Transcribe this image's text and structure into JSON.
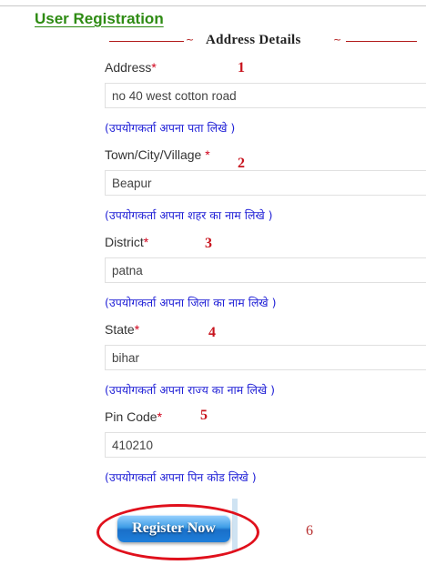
{
  "page_title": "User Registration",
  "section": {
    "ornament_left": "~",
    "heading": "Address Details",
    "ornament_right": "~"
  },
  "fields": [
    {
      "label": "Address",
      "required_mark": "*",
      "value": "no 40 west cotton road",
      "hint": "(उपयोगकर्ता अपना पता लिखे )",
      "annotation": "1"
    },
    {
      "label": "Town/City/Village ",
      "required_mark": "*",
      "value": "Beapur",
      "hint": "(उपयोगकर्ता अपना शहर का नाम लिखे )",
      "annotation": "2"
    },
    {
      "label": "District",
      "required_mark": "*",
      "value": "patna",
      "hint": "(उपयोगकर्ता अपना जिला का नाम लिखे )",
      "annotation": "3"
    },
    {
      "label": "State",
      "required_mark": "*",
      "value": "bihar",
      "hint": "(उपयोगकर्ता अपना राज्य का नाम लिखे )",
      "annotation": "4"
    },
    {
      "label": "Pin Code",
      "required_mark": "*",
      "value": "410210",
      "hint": "(उपयोगकर्ता अपना पिन कोड लिखे )",
      "annotation": "5"
    }
  ],
  "register_button": {
    "label": "Register Now",
    "annotation": "6"
  },
  "colors": {
    "title_green": "#2e8b13",
    "required_red": "#d0021b",
    "hint_blue": "#1f1fd6",
    "annotation_red": "#c8141e"
  }
}
